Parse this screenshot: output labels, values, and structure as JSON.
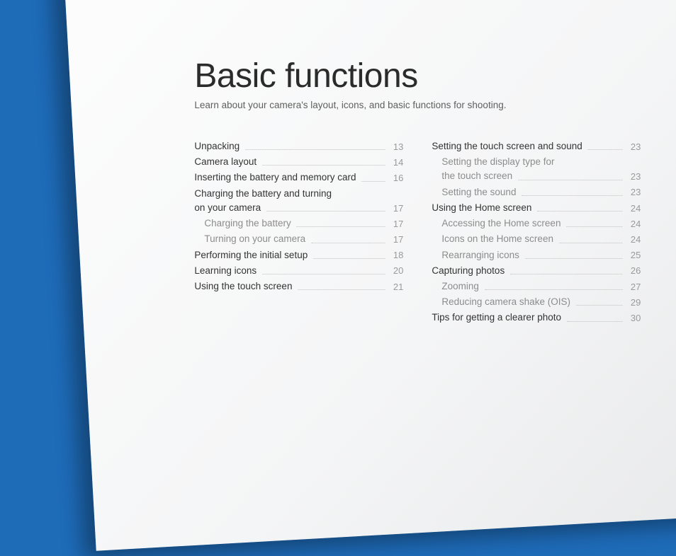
{
  "title": "Basic functions",
  "subtitle": "Learn about your camera's layout, icons, and basic functions for shooting.",
  "col1": [
    {
      "label": "Unpacking",
      "page": "13",
      "sub": false
    },
    {
      "label": "Camera layout",
      "page": "14",
      "sub": false
    },
    {
      "label": "Inserting the battery and memory card",
      "page": "16",
      "sub": false
    },
    {
      "label": "Charging the battery and turning",
      "label2": "on your camera",
      "page": "17",
      "sub": false,
      "multi": true
    },
    {
      "label": "Charging the battery",
      "page": "17",
      "sub": true
    },
    {
      "label": "Turning on your camera",
      "page": "17",
      "sub": true
    },
    {
      "label": "Performing the initial setup",
      "page": "18",
      "sub": false
    },
    {
      "label": "Learning icons",
      "page": "20",
      "sub": false
    },
    {
      "label": "Using the touch screen",
      "page": "21",
      "sub": false
    }
  ],
  "col2": [
    {
      "label": "Setting the touch screen and sound",
      "page": "23",
      "sub": false
    },
    {
      "label": "Setting the display type for",
      "label2": "the touch screen",
      "page": "23",
      "sub": true,
      "multi": true
    },
    {
      "label": "Setting the sound",
      "page": "23",
      "sub": true
    },
    {
      "label": "Using the Home screen",
      "page": "24",
      "sub": false
    },
    {
      "label": "Accessing the Home screen",
      "page": "24",
      "sub": true
    },
    {
      "label": "Icons on the Home screen",
      "page": "24",
      "sub": true
    },
    {
      "label": "Rearranging icons",
      "page": "25",
      "sub": true
    },
    {
      "label": "Capturing photos",
      "page": "26",
      "sub": false
    },
    {
      "label": "Zooming",
      "page": "27",
      "sub": true
    },
    {
      "label": "Reducing camera shake (OIS)",
      "page": "29",
      "sub": true
    },
    {
      "label": "Tips for getting a clearer photo",
      "page": "30",
      "sub": false
    }
  ]
}
